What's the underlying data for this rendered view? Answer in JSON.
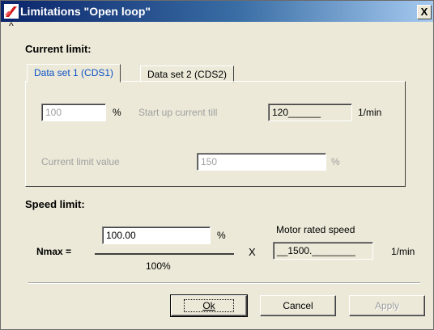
{
  "window": {
    "title": "Limitations \"Open loop\"",
    "close_label": "X",
    "caret": "^"
  },
  "current_limit": {
    "heading": "Current limit:",
    "tabs": [
      {
        "label": "Data set 1 (CDS1)",
        "active": true
      },
      {
        "label": "Data set 2 (CDS2)",
        "active": false
      }
    ],
    "percent_value": "100",
    "percent_unit": "%",
    "startup_label": "Start up current till",
    "startup_value": "120______",
    "startup_unit": "1/min",
    "limit_label": "Current limit value",
    "limit_value": "150",
    "limit_unit": "%"
  },
  "speed_limit": {
    "heading": "Speed limit:",
    "nmax_label": "Nmax =",
    "numerator_value": "100.00",
    "numerator_unit": "%",
    "denominator": "100%",
    "multiply": "X",
    "rated_label": "Motor rated speed",
    "rated_value": "__1500.________",
    "rated_unit": "1/min"
  },
  "buttons": {
    "ok": "Ok",
    "cancel": "Cancel",
    "apply": "Apply"
  }
}
